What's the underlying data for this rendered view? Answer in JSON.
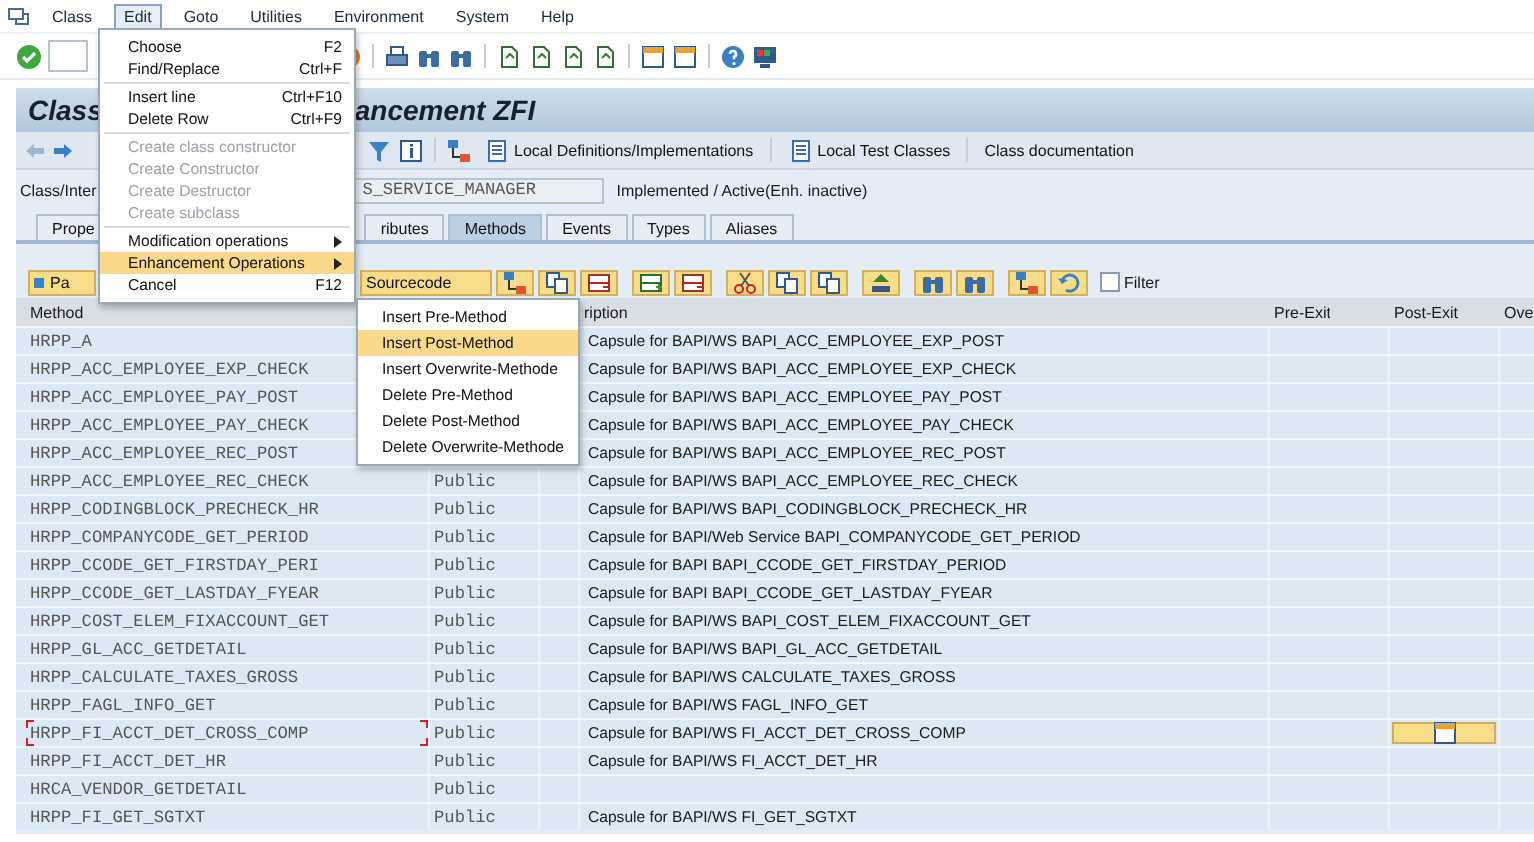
{
  "menu_bar": {
    "items": [
      {
        "label": "Class",
        "selected": false
      },
      {
        "label": "Edit",
        "selected": true
      },
      {
        "label": "Goto",
        "selected": false
      },
      {
        "label": "Utilities",
        "selected": false
      },
      {
        "label": "Environment",
        "selected": false
      },
      {
        "label": "System",
        "selected": false
      },
      {
        "label": "Help",
        "selected": false
      }
    ]
  },
  "title": {
    "left": "Class",
    "right": "ancement ZFI"
  },
  "app_toolbar": {
    "buttons": [
      "Local Definitions/Implementations",
      "Local Test Classes",
      "Class documentation"
    ]
  },
  "class_row": {
    "label": "Class/Inter",
    "value": "S_SERVICE_MANAGER",
    "status": "Implemented / Active(Enh. inactive)"
  },
  "tabs": [
    {
      "label": "Prope",
      "selected": false
    },
    {
      "label": "ributes",
      "selected": false
    },
    {
      "label": "Methods",
      "selected": true
    },
    {
      "label": "Events",
      "selected": false
    },
    {
      "label": "Types",
      "selected": false
    },
    {
      "label": "Aliases",
      "selected": false
    }
  ],
  "method_toolbar": {
    "parameters_button": "Pa",
    "sourcecode_button": "Sourcecode",
    "filter": {
      "label": "Filter",
      "checked": false
    }
  },
  "table": {
    "columns": [
      "Method",
      "ription",
      "Pre-Exit",
      "Post-Exit",
      "Ove"
    ],
    "rows": [
      {
        "method": "HRPP_A",
        "description": "Capsule for BAPI/WS BAPI_ACC_EMPLOYEE_EXP_POST",
        "post_exit": false,
        "focused": false
      },
      {
        "method": "HRPP_ACC_EMPLOYEE_EXP_CHECK",
        "description": "Capsule for BAPI/WS BAPI_ACC_EMPLOYEE_EXP_CHECK",
        "post_exit": false,
        "focused": false
      },
      {
        "method": "HRPP_ACC_EMPLOYEE_PAY_POST",
        "description": "Capsule for BAPI/WS BAPI_ACC_EMPLOYEE_PAY_POST",
        "post_exit": false,
        "focused": false
      },
      {
        "method": "HRPP_ACC_EMPLOYEE_PAY_CHECK",
        "description": "Capsule for BAPI/WS BAPI_ACC_EMPLOYEE_PAY_CHECK",
        "post_exit": false,
        "focused": false
      },
      {
        "method": "HRPP_ACC_EMPLOYEE_REC_POST",
        "description": "Capsule for BAPI/WS BAPI_ACC_EMPLOYEE_REC_POST",
        "post_exit": false,
        "focused": false
      },
      {
        "method": "HRPP_ACC_EMPLOYEE_REC_CHECK",
        "level": "Public",
        "description": "Capsule for BAPI/WS BAPI_ACC_EMPLOYEE_REC_CHECK",
        "post_exit": false,
        "focused": false
      },
      {
        "method": "HRPP_CODINGBLOCK_PRECHECK_HR",
        "level": "Public",
        "description": "Capsule for BAPI/WS BAPI_CODINGBLOCK_PRECHECK_HR",
        "post_exit": false,
        "focused": false
      },
      {
        "method": "HRPP_COMPANYCODE_GET_PERIOD",
        "level": "Public",
        "description": "Capsule for BAPI/Web Service BAPI_COMPANYCODE_GET_PERIOD",
        "post_exit": false,
        "focused": false
      },
      {
        "method": "HRPP_CCODE_GET_FIRSTDAY_PERI",
        "level": "Public",
        "description": "Capsule for BAPI BAPI_CCODE_GET_FIRSTDAY_PERIOD",
        "post_exit": false,
        "focused": false
      },
      {
        "method": "HRPP_CCODE_GET_LASTDAY_FYEAR",
        "level": "Public",
        "description": "Capsule for BAPI BAPI_CCODE_GET_LASTDAY_FYEAR",
        "post_exit": false,
        "focused": false
      },
      {
        "method": "HRPP_COST_ELEM_FIXACCOUNT_GET",
        "level": "Public",
        "description": "Capsule for BAPI/WS BAPI_COST_ELEM_FIXACCOUNT_GET",
        "post_exit": false,
        "focused": false
      },
      {
        "method": "HRPP_GL_ACC_GETDETAIL",
        "level": "Public",
        "description": "Capsule for BAPI/WS BAPI_GL_ACC_GETDETAIL",
        "post_exit": false,
        "focused": false
      },
      {
        "method": "HRPP_CALCULATE_TAXES_GROSS",
        "level": "Public",
        "description": "Capsule for BAPI/WS CALCULATE_TAXES_GROSS",
        "post_exit": false,
        "focused": false
      },
      {
        "method": "HRPP_FAGL_INFO_GET",
        "level": "Public",
        "description": "Capsule for BAPI/WS FAGL_INFO_GET",
        "post_exit": false,
        "focused": false
      },
      {
        "method": "HRPP_FI_ACCT_DET_CROSS_COMP",
        "level": "Public",
        "description": "Capsule for BAPI/WS FI_ACCT_DET_CROSS_COMP",
        "post_exit": true,
        "focused": true
      },
      {
        "method": "HRPP_FI_ACCT_DET_HR",
        "level": "Public",
        "description": "Capsule for BAPI/WS FI_ACCT_DET_HR",
        "post_exit": false,
        "focused": false
      },
      {
        "method": "HRCA_VENDOR_GETDETAIL",
        "level": "Public",
        "post_exit": false,
        "focused": false
      },
      {
        "method": "HRPP_FI_GET_SGTXT",
        "level": "Public",
        "description": "Capsule for BAPI/WS FI_GET_SGTXT",
        "post_exit": false,
        "focused": false
      }
    ]
  },
  "edit_menu": {
    "items": [
      {
        "kind": "item",
        "label": "Choose",
        "shortcut": "F2",
        "disabled": false,
        "selected": false,
        "submenu": false
      },
      {
        "kind": "item",
        "label": "Find/Replace",
        "shortcut": "Ctrl+F",
        "disabled": false,
        "selected": false,
        "submenu": false
      },
      {
        "kind": "separator"
      },
      {
        "kind": "item",
        "label": "Insert line",
        "shortcut": "Ctrl+F10",
        "disabled": false,
        "selected": false,
        "submenu": false
      },
      {
        "kind": "item",
        "label": "Delete Row",
        "shortcut": "Ctrl+F9",
        "disabled": false,
        "selected": false,
        "submenu": false
      },
      {
        "kind": "separator"
      },
      {
        "kind": "item",
        "label": "Create class constructor",
        "disabled": true,
        "selected": false,
        "submenu": false
      },
      {
        "kind": "item",
        "label": "Create Constructor",
        "disabled": true,
        "selected": false,
        "submenu": false
      },
      {
        "kind": "item",
        "label": "Create Destructor",
        "disabled": true,
        "selected": false,
        "submenu": false
      },
      {
        "kind": "item",
        "label": "Create subclass",
        "disabled": true,
        "selected": false,
        "submenu": false
      },
      {
        "kind": "separator"
      },
      {
        "kind": "item",
        "label": "Modification operations",
        "disabled": false,
        "selected": false,
        "submenu": true
      },
      {
        "kind": "item",
        "label": "Enhancement Operations",
        "disabled": false,
        "selected": true,
        "submenu": true
      },
      {
        "kind": "item",
        "label": "Cancel",
        "shortcut": "F12",
        "disabled": false,
        "selected": false,
        "submenu": false
      }
    ]
  },
  "enhancement_submenu": {
    "items": [
      {
        "label": "Insert Pre-Method",
        "selected": false
      },
      {
        "label": "Insert Post-Method",
        "selected": true
      },
      {
        "label": "Insert Overwrite-Methode",
        "selected": false
      },
      {
        "label": "Delete Pre-Method",
        "selected": false
      },
      {
        "label": "Delete Post-Method",
        "selected": false
      },
      {
        "label": "Delete Overwrite-Methode",
        "selected": false
      }
    ]
  }
}
